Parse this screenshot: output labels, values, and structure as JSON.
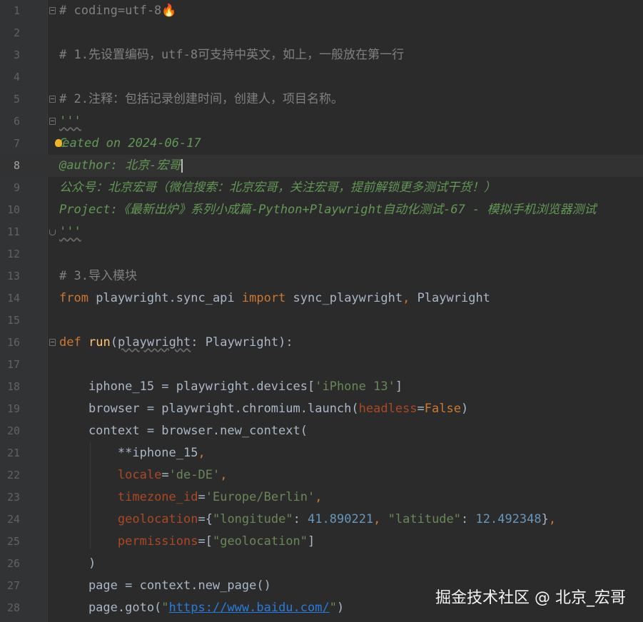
{
  "editor": {
    "language": "python",
    "current_line": 8,
    "lines": [
      {
        "n": "1",
        "t1": "# coding=utf-8",
        "t2": "🔥"
      },
      {
        "n": "2"
      },
      {
        "n": "3",
        "t1": "# 1.先设置编码，utf-8可支持中英文，如上，一般放在第一行"
      },
      {
        "n": "4"
      },
      {
        "n": "5",
        "t1": "# 2.注释：包括记录创建时间，创建人，项目名称。"
      },
      {
        "n": "6",
        "t1": "'''"
      },
      {
        "n": "7",
        "t1": "C",
        "t2": "eated on 2024-06-17"
      },
      {
        "n": "8",
        "t1": "@author: 北京-宏哥"
      },
      {
        "n": "9",
        "t1": "公众号：北京宏哥（微信搜索：北京宏哥，关注宏哥，提前解锁更多测试干货！）"
      },
      {
        "n": "10",
        "t1": "Project:《最新出炉》系列小成篇-Python+Playwright自动化测试-67 - 模拟手机浏览器测试"
      },
      {
        "n": "11",
        "t1": "'''"
      },
      {
        "n": "12"
      },
      {
        "n": "13",
        "t1": "# 3.导入模块"
      },
      {
        "n": "14",
        "t1": "from",
        "t2": " playwright.sync_api ",
        "t3": "import",
        "t4": " sync_playwright",
        "t5": ",",
        "t6": " Playwright"
      },
      {
        "n": "15"
      },
      {
        "n": "16",
        "t1": "def",
        "t2": " ",
        "t3": "run",
        "t4": "(",
        "t5": "playwright",
        "t6": ": Playwright):"
      },
      {
        "n": "17"
      },
      {
        "n": "18",
        "t1": "    iphone_15 = playwright.devices[",
        "t2": "'iPhone 13'",
        "t3": "]"
      },
      {
        "n": "19",
        "t1": "    browser = playwright.chromium.launch(",
        "t2": "headless",
        "t3": "=",
        "t4": "False",
        "t5": ")"
      },
      {
        "n": "20",
        "t1": "    context = browser.new_context("
      },
      {
        "n": "21",
        "t1": "        **iphone_15",
        "t2": ","
      },
      {
        "n": "22",
        "t1": "        ",
        "t2": "locale",
        "t3": "=",
        "t4": "'de-DE'",
        "t5": ","
      },
      {
        "n": "23",
        "t1": "        ",
        "t2": "timezone_id",
        "t3": "=",
        "t4": "'Europe/Berlin'",
        "t5": ","
      },
      {
        "n": "24",
        "t1": "        ",
        "t2": "geolocation",
        "t3": "={",
        "t4": "\"longitude\"",
        "t5": ": ",
        "t6": "41.890221",
        "t7": ", ",
        "t8": "\"latitude\"",
        "t9": ": ",
        "t10": "12.492348",
        "t11": "}",
        "t12": ","
      },
      {
        "n": "25",
        "t1": "        ",
        "t2": "permissions",
        "t3": "=[",
        "t4": "\"geolocation\"",
        "t5": "]"
      },
      {
        "n": "26",
        "t1": "    )"
      },
      {
        "n": "27",
        "t1": "    page = context.new_page()"
      },
      {
        "n": "28",
        "t1": "    page.goto(",
        "t2": "\"",
        "t3": "https://www.baidu.com/",
        "t4": "\"",
        "t5": ")"
      }
    ]
  },
  "watermark": "掘金技术社区 @ 北京_宏哥",
  "colors": {
    "background": "#2b2b2b",
    "gutter": "#313335",
    "comment": "#808080",
    "docstring": "#629755",
    "keyword": "#cc7832",
    "function": "#ffc66d",
    "string": "#6a8759",
    "number": "#6897bb",
    "param": "#aa4926"
  }
}
